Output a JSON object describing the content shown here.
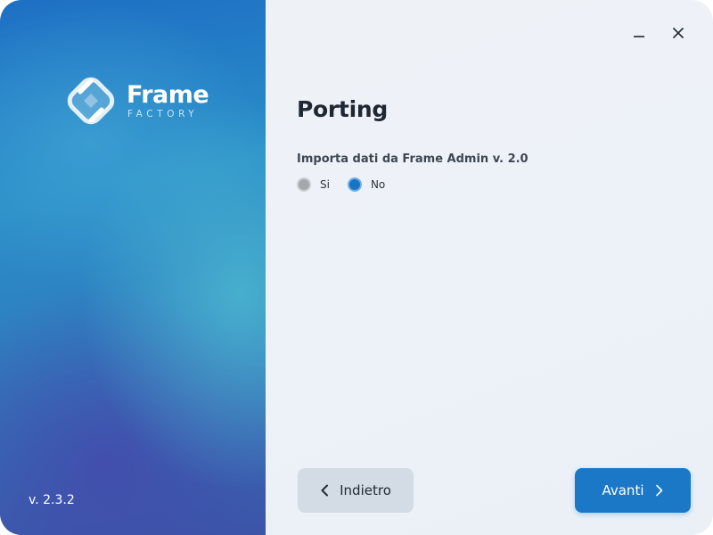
{
  "sidebar": {
    "logo": {
      "title": "Frame",
      "subtitle": "FACTORY"
    },
    "version": "v. 2.3.2"
  },
  "window_controls": {
    "minimize_icon": "minimize-icon",
    "close_icon": "close-icon"
  },
  "main": {
    "title": "Porting",
    "question": "Importa dati da Frame Admin v. 2.0",
    "radio_options": [
      {
        "label": "Si",
        "selected": false
      },
      {
        "label": "No",
        "selected": true
      }
    ]
  },
  "footer": {
    "back_label": "Indietro",
    "next_label": "Avanti"
  },
  "colors": {
    "accent": "#1a78c6",
    "back_button": "#d3dbe4",
    "radio_unselected": "#a4a8ad"
  }
}
